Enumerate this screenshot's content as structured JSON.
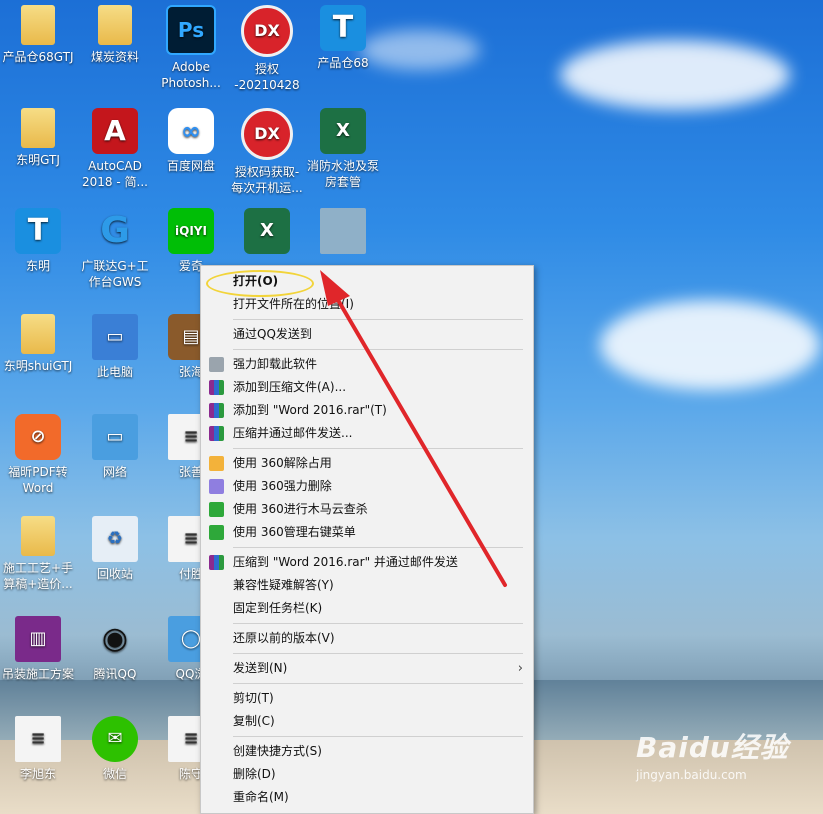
{
  "desktop": {
    "icons": [
      {
        "label": "产品仓68GTJ",
        "icon": "folder-icon"
      },
      {
        "label": "煤炭资料",
        "icon": "folder-icon"
      },
      {
        "label": "Adobe Photosh...",
        "icon": "photoshop-icon",
        "glyph": "Ps"
      },
      {
        "label": "授权 -20210428",
        "icon": "dx-icon",
        "glyph": "DX"
      },
      {
        "label": "产品仓68",
        "icon": "t-app-icon",
        "glyph": "T"
      },
      {
        "label": "东明GTJ",
        "icon": "folder-icon"
      },
      {
        "label": "AutoCAD 2018 - 简...",
        "icon": "autocad-icon",
        "glyph": "A"
      },
      {
        "label": "百度网盘",
        "icon": "baidu-netdisk-icon",
        "glyph": "∞"
      },
      {
        "label": "授权码获取-每次开机运...",
        "icon": "dx-icon",
        "glyph": "DX"
      },
      {
        "label": "消防水池及泵房套管",
        "icon": "excel-icon",
        "glyph": "X"
      },
      {
        "label": "东明",
        "icon": "t-app-icon",
        "glyph": "T"
      },
      {
        "label": "广联达G+工作台GWS",
        "icon": "glodon-icon",
        "glyph": "G"
      },
      {
        "label": "爱奇",
        "icon": "iqiyi-icon",
        "glyph": "iQIYI"
      },
      {
        "label": "",
        "icon": "excel-file-icon",
        "glyph": "X"
      },
      {
        "label": "",
        "icon": "image-file-icon",
        "glyph": ""
      },
      {
        "label": "东明shuiGTJ",
        "icon": "folder-icon"
      },
      {
        "label": "此电脑",
        "icon": "computer-icon",
        "glyph": "▭"
      },
      {
        "label": "张海",
        "icon": "briefcase-icon",
        "glyph": "▤"
      },
      {
        "label": "福昕PDF转Word",
        "icon": "foxit-icon",
        "glyph": "⊘"
      },
      {
        "label": "网络",
        "icon": "network-icon",
        "glyph": "▭"
      },
      {
        "label": "张善",
        "icon": "document-icon",
        "glyph": "≡"
      },
      {
        "label": "施工工艺+手算稿+造价...",
        "icon": "folder-icon"
      },
      {
        "label": "回收站",
        "icon": "recycle-bin-icon",
        "glyph": "♻"
      },
      {
        "label": "付胜",
        "icon": "document-icon",
        "glyph": "≡"
      },
      {
        "label": "吊装施工方案",
        "icon": "winrar-icon",
        "glyph": "▥"
      },
      {
        "label": "腾讯QQ",
        "icon": "qq-icon",
        "glyph": "◉"
      },
      {
        "label": "QQ浏",
        "icon": "qq-browser-icon",
        "glyph": "◯"
      },
      {
        "label": "李旭东",
        "icon": "document-icon",
        "glyph": "≡"
      },
      {
        "label": "微信",
        "icon": "wechat-icon",
        "glyph": "✉"
      },
      {
        "label": "陈守",
        "icon": "document-icon",
        "glyph": "≡"
      }
    ]
  },
  "context_menu": {
    "items": [
      {
        "label": "打开(O)",
        "bold": true,
        "icon": ""
      },
      {
        "label": "打开文件所在的位置(I)",
        "icon": ""
      },
      {
        "sep": true
      },
      {
        "label": "通过QQ发送到",
        "icon": ""
      },
      {
        "sep": true
      },
      {
        "label": "强力卸载此软件",
        "icon": "trash-icon"
      },
      {
        "label": "添加到压缩文件(A)...",
        "icon": "winrar-icon"
      },
      {
        "label": "添加到 \"Word 2016.rar\"(T)",
        "icon": "winrar-icon"
      },
      {
        "label": "压缩并通过邮件发送...",
        "icon": "winrar-icon"
      },
      {
        "sep": true
      },
      {
        "label": "使用 360解除占用",
        "icon": "360-unlock-icon"
      },
      {
        "label": "使用 360强力删除",
        "icon": "360-delete-icon"
      },
      {
        "label": "使用 360进行木马云查杀",
        "icon": "360-scan-icon"
      },
      {
        "label": "使用 360管理右键菜单",
        "icon": "360-manage-icon"
      },
      {
        "sep": true
      },
      {
        "label": "压缩到 \"Word 2016.rar\" 并通过邮件发送",
        "icon": "winrar-icon"
      },
      {
        "label": "兼容性疑难解答(Y)",
        "icon": ""
      },
      {
        "label": "固定到任务栏(K)",
        "icon": ""
      },
      {
        "sep": true
      },
      {
        "label": "还原以前的版本(V)",
        "icon": ""
      },
      {
        "sep": true
      },
      {
        "label": "发送到(N)",
        "icon": "",
        "submenu": true
      },
      {
        "sep": true
      },
      {
        "label": "剪切(T)",
        "icon": ""
      },
      {
        "label": "复制(C)",
        "icon": ""
      },
      {
        "sep": true
      },
      {
        "label": "创建快捷方式(S)",
        "icon": ""
      },
      {
        "label": "删除(D)",
        "icon": ""
      },
      {
        "label": "重命名(M)",
        "icon": ""
      }
    ],
    "submenu_arrow": "›"
  },
  "watermark": {
    "logo": "Baidu经验",
    "url": "jingyan.baidu.com"
  },
  "colors": {
    "highlight": "#f2d43a",
    "arrow": "#e0262a",
    "menu_bg": "#f2f2f2"
  }
}
